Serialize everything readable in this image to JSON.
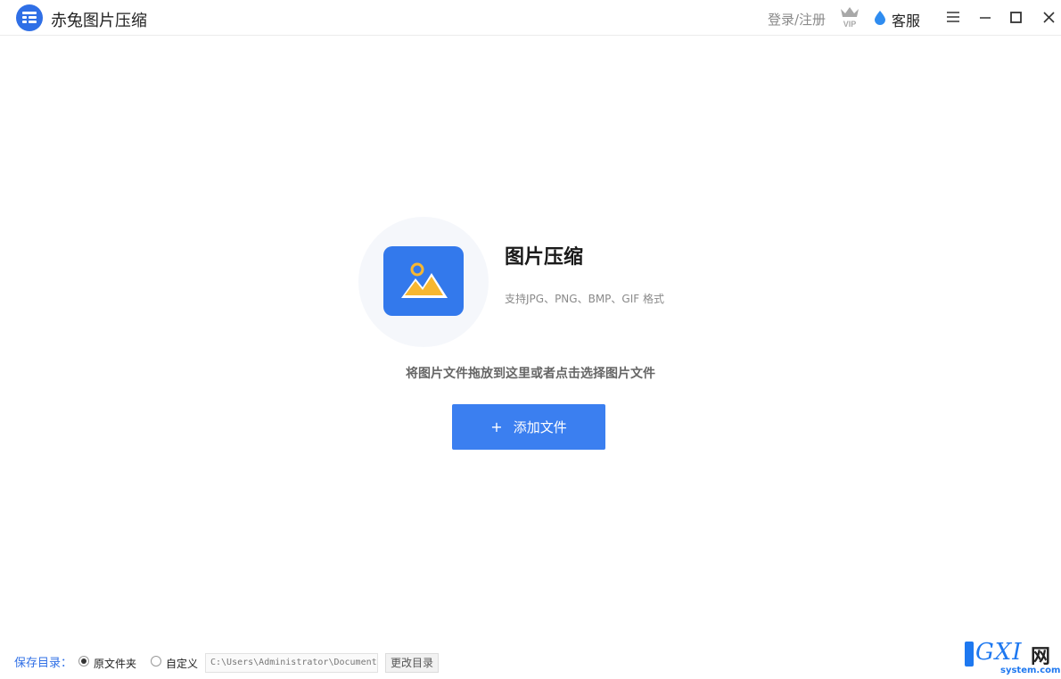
{
  "app": {
    "title": "赤兔图片压缩"
  },
  "header": {
    "login_label": "登录/注册",
    "vip_icon": "vip-crown-icon",
    "service_label": "客服",
    "icons": [
      "menu-icon",
      "minimize-icon",
      "maximize-icon",
      "close-icon"
    ]
  },
  "main": {
    "title": "图片压缩",
    "formats": "支持JPG、PNG、BMP、GIF 格式",
    "drop_hint": "将图片文件拖放到这里或者点击选择图片文件",
    "add_button_plus": "+",
    "add_button_label": "添加文件"
  },
  "footer": {
    "save_label": "保存目录：",
    "options": [
      {
        "label": "原文件夹",
        "checked": true
      },
      {
        "label": "自定义",
        "checked": false
      }
    ],
    "path_value": "C:\\Users\\Administrator\\Documents",
    "change_button": "更改目录"
  },
  "watermark": {
    "main": "GXI",
    "cn": "网",
    "sub": "system.com"
  },
  "colors": {
    "accent": "#3b7ff0",
    "logo": "#2f6fe6",
    "tile": "#3379ec",
    "mountain": "#f7b731"
  }
}
